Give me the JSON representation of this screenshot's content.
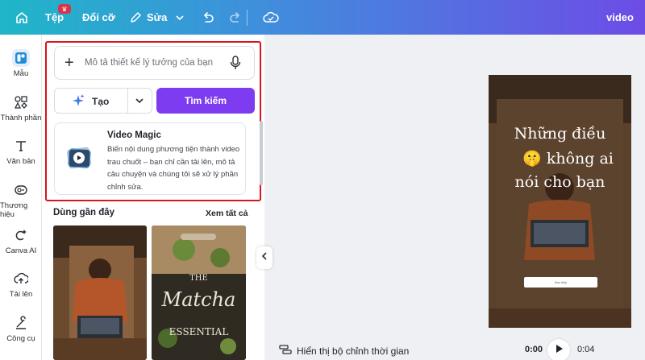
{
  "topbar": {
    "file_label": "Tệp",
    "file_badge": "♛",
    "resize_label": "Đổi cỡ",
    "edit_label": "Sửa",
    "doc_title": "video"
  },
  "rail": {
    "items": [
      {
        "label": "Mẫu",
        "icon": "templates-icon"
      },
      {
        "label": "Thành phần",
        "icon": "elements-icon"
      },
      {
        "label": "Văn bản",
        "icon": "text-icon"
      },
      {
        "label": "Thương hiệu",
        "icon": "brand-icon"
      },
      {
        "label": "Canva AI",
        "icon": "canva-ai-icon"
      },
      {
        "label": "Tải lên",
        "icon": "upload-icon"
      },
      {
        "label": "Công cụ",
        "icon": "tools-icon"
      }
    ]
  },
  "panel": {
    "search_placeholder": "Mô tả thiết kế lý tưởng của bạn",
    "create_label": "Tạo",
    "search_button": "Tìm kiếm",
    "magic_card": {
      "title": "Video Magic",
      "description": "Biến nội dung phương tiện thành video trau chuốt – bạn chỉ cần tải lên, mô tả câu chuyện và chúng tôi sẽ xử lý phần chỉnh sửa."
    },
    "recent_title": "Dùng gần đây",
    "see_all": "Xem tất cả",
    "thumb2_text": {
      "line1": "THE",
      "line2": "Matcha",
      "line3": "ESSENTIAL"
    }
  },
  "canvas": {
    "line1": "Những điều",
    "line2": "không ai",
    "line3": "nói cho bạn",
    "emoji": "🤫",
    "button_text": "Đọc tiếp"
  },
  "footer": {
    "timeline_label": "Hiển thị bộ chỉnh thời gian",
    "current_time": "0:00",
    "total_time": "0:04"
  },
  "colors": {
    "accent": "#7d3cf0",
    "highlight": "#d9141b"
  }
}
